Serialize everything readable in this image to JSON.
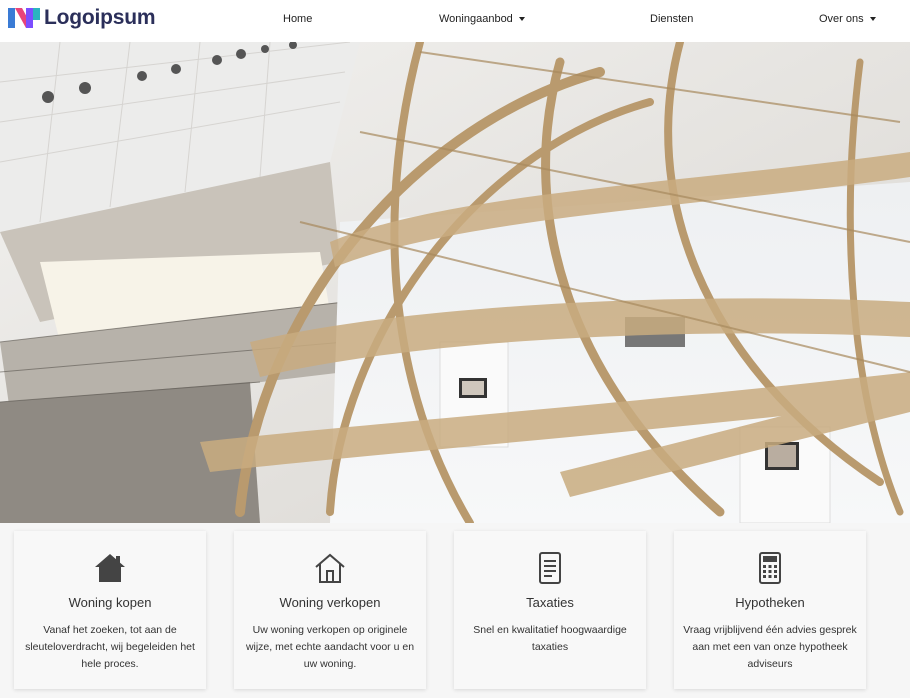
{
  "header": {
    "logo_text": "Logoipsum",
    "nav": {
      "home": "Home",
      "woningaanbod": "Woningaanbod",
      "diensten": "Diensten",
      "over_ons": "Over ons"
    }
  },
  "hero": {
    "image": "atrium-globe-structure"
  },
  "cards": [
    {
      "icon": "house-filled-icon",
      "title": "Woning kopen",
      "desc": "Vanaf het zoeken, tot aan de sleuteloverdracht, wij begeleiden het hele proces."
    },
    {
      "icon": "house-outline-icon",
      "title": "Woning verkopen",
      "desc": "Uw woning verkopen op originele wijze, met echte aandacht voor u en uw woning."
    },
    {
      "icon": "document-icon",
      "title": "Taxaties",
      "desc": "Snel en kwalitatief hoogwaardige taxaties"
    },
    {
      "icon": "calculator-icon",
      "title": "Hypotheken",
      "desc": "Vraag vrijblijvend één advies gesprek aan met een van onze hypotheek adviseurs"
    }
  ],
  "colors": {
    "logo_text": "#2b2f5a",
    "card_bg": "#f8f8f8",
    "icon": "#444444"
  }
}
